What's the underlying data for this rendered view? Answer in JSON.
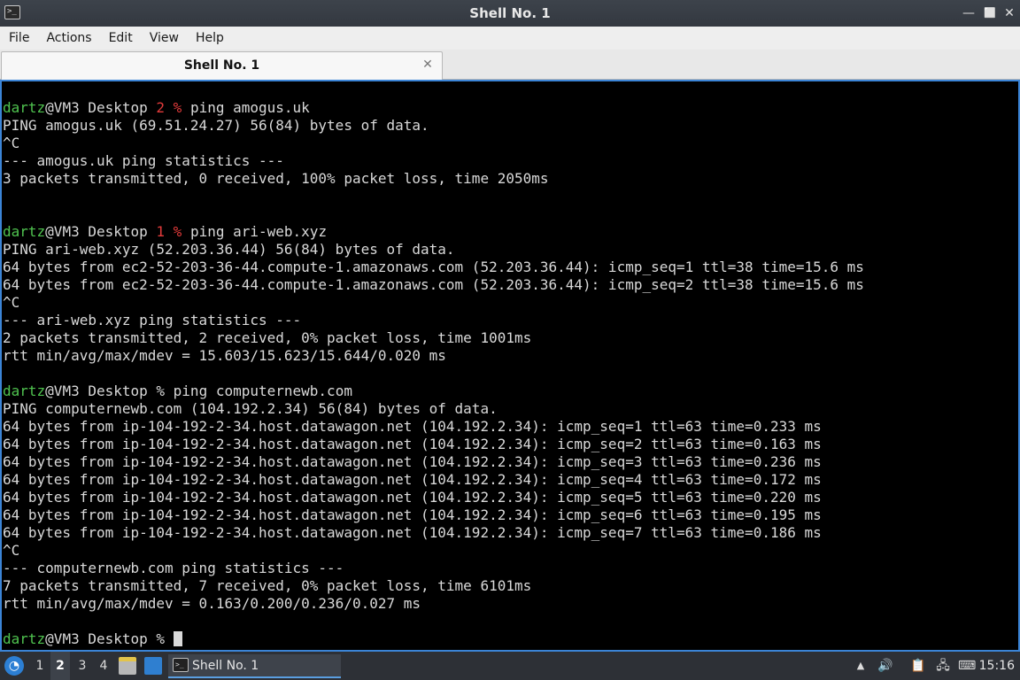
{
  "window": {
    "title": "Shell No. 1",
    "app_icon_glyph": ">_",
    "minimize_glyph": "—",
    "maximize_glyph": "⬜",
    "close_glyph": "✕"
  },
  "menu": {
    "items": [
      "File",
      "Actions",
      "Edit",
      "View",
      "Help"
    ]
  },
  "tabs": [
    {
      "label": "Shell No. 1",
      "close_glyph": "✕"
    }
  ],
  "terminal": {
    "lines": [
      [
        {
          "t": "dartz",
          "c": "green"
        },
        {
          "t": "@VM3 Desktop "
        },
        {
          "t": "2 %",
          "c": "red"
        },
        {
          "t": " ping amogus.uk"
        }
      ],
      [
        {
          "t": "PING amogus.uk (69.51.24.27) 56(84) bytes of data."
        }
      ],
      [
        {
          "t": "^C"
        }
      ],
      [
        {
          "t": "--- amogus.uk ping statistics ---"
        }
      ],
      [
        {
          "t": "3 packets transmitted, 0 received, 100% packet loss, time 2050ms"
        }
      ],
      [
        {
          "t": ""
        }
      ],
      [
        {
          "t": ""
        }
      ],
      [
        {
          "t": "dartz",
          "c": "green"
        },
        {
          "t": "@VM3 Desktop "
        },
        {
          "t": "1 %",
          "c": "red"
        },
        {
          "t": " ping ari-web.xyz"
        }
      ],
      [
        {
          "t": "PING ari-web.xyz (52.203.36.44) 56(84) bytes of data."
        }
      ],
      [
        {
          "t": "64 bytes from ec2-52-203-36-44.compute-1.amazonaws.com (52.203.36.44): icmp_seq=1 ttl=38 time=15.6 ms"
        }
      ],
      [
        {
          "t": "64 bytes from ec2-52-203-36-44.compute-1.amazonaws.com (52.203.36.44): icmp_seq=2 ttl=38 time=15.6 ms"
        }
      ],
      [
        {
          "t": "^C"
        }
      ],
      [
        {
          "t": "--- ari-web.xyz ping statistics ---"
        }
      ],
      [
        {
          "t": "2 packets transmitted, 2 received, 0% packet loss, time 1001ms"
        }
      ],
      [
        {
          "t": "rtt min/avg/max/mdev = 15.603/15.623/15.644/0.020 ms"
        }
      ],
      [
        {
          "t": ""
        }
      ],
      [
        {
          "t": "dartz",
          "c": "green"
        },
        {
          "t": "@VM3 Desktop % ping computernewb.com"
        }
      ],
      [
        {
          "t": "PING computernewb.com (104.192.2.34) 56(84) bytes of data."
        }
      ],
      [
        {
          "t": "64 bytes from ip-104-192-2-34.host.datawagon.net (104.192.2.34): icmp_seq=1 ttl=63 time=0.233 ms"
        }
      ],
      [
        {
          "t": "64 bytes from ip-104-192-2-34.host.datawagon.net (104.192.2.34): icmp_seq=2 ttl=63 time=0.163 ms"
        }
      ],
      [
        {
          "t": "64 bytes from ip-104-192-2-34.host.datawagon.net (104.192.2.34): icmp_seq=3 ttl=63 time=0.236 ms"
        }
      ],
      [
        {
          "t": "64 bytes from ip-104-192-2-34.host.datawagon.net (104.192.2.34): icmp_seq=4 ttl=63 time=0.172 ms"
        }
      ],
      [
        {
          "t": "64 bytes from ip-104-192-2-34.host.datawagon.net (104.192.2.34): icmp_seq=5 ttl=63 time=0.220 ms"
        }
      ],
      [
        {
          "t": "64 bytes from ip-104-192-2-34.host.datawagon.net (104.192.2.34): icmp_seq=6 ttl=63 time=0.195 ms"
        }
      ],
      [
        {
          "t": "64 bytes from ip-104-192-2-34.host.datawagon.net (104.192.2.34): icmp_seq=7 ttl=63 time=0.186 ms"
        }
      ],
      [
        {
          "t": "^C"
        }
      ],
      [
        {
          "t": "--- computernewb.com ping statistics ---"
        }
      ],
      [
        {
          "t": "7 packets transmitted, 7 received, 0% packet loss, time 6101ms"
        }
      ],
      [
        {
          "t": "rtt min/avg/max/mdev = 0.163/0.200/0.236/0.027 ms"
        }
      ],
      [
        {
          "t": ""
        }
      ],
      [
        {
          "t": "dartz",
          "c": "green"
        },
        {
          "t": "@VM3 Desktop % "
        },
        {
          "cursor": true
        }
      ]
    ]
  },
  "taskbar": {
    "start_glyph": "◔",
    "workspaces": [
      "1",
      "2",
      "3",
      "4"
    ],
    "active_workspace": "2",
    "task_label": "Shell No. 1",
    "task_icon_glyph": ">_",
    "tray": {
      "up_glyph": "▲",
      "volume_glyph": "🔊",
      "clipboard_glyph": "📋",
      "network_glyph": "🖧",
      "keyboard_glyph": "⌨"
    },
    "clock": "15:16"
  },
  "colors": {
    "accent": "#3b84d6",
    "prompt_user": "#4fc34f",
    "prompt_status": "#e33b3b",
    "terminal_bg": "#000000",
    "terminal_fg": "#d9d9d9"
  }
}
